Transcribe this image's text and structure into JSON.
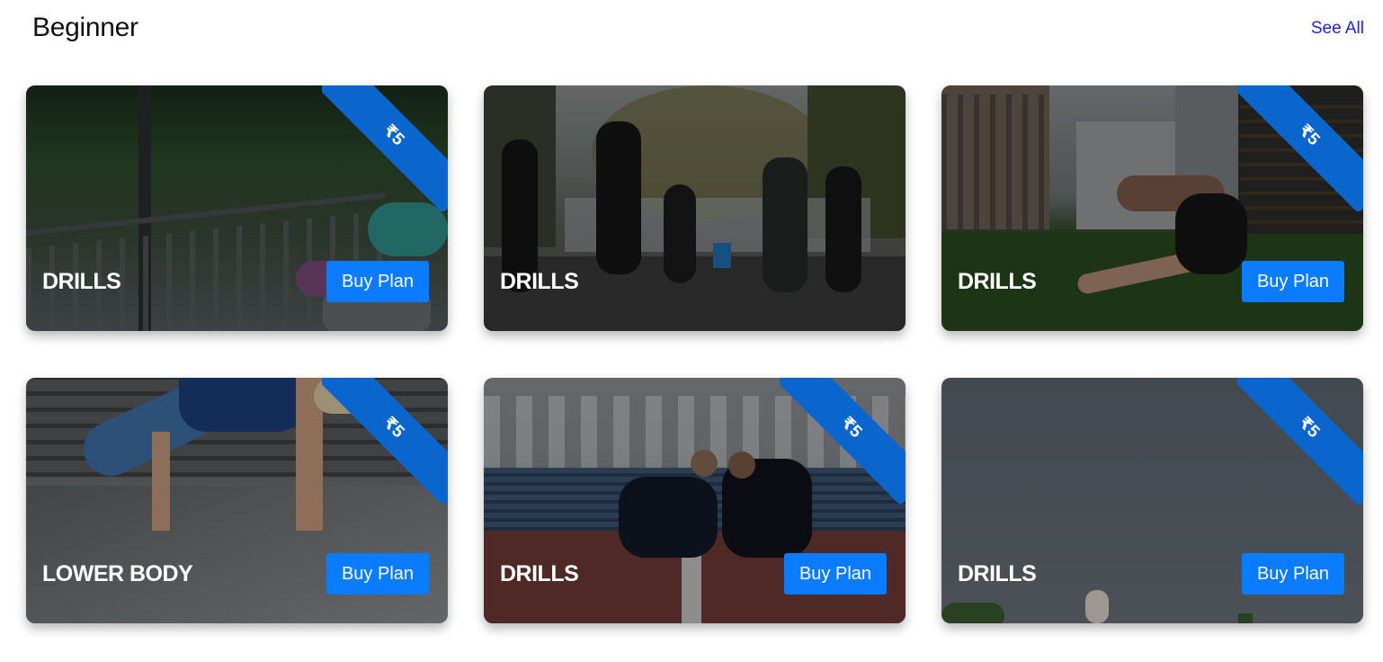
{
  "section": {
    "title": "Beginner",
    "see_all_label": "See All"
  },
  "cards": [
    {
      "title": "DRILLS",
      "button_label": "Buy Plan",
      "price_badge": "₹5",
      "has_badge": true
    },
    {
      "title": "DRILLS",
      "button_label": "Buy Plan",
      "price_badge": "",
      "has_badge": false
    },
    {
      "title": "DRILLS",
      "button_label": "Buy Plan",
      "price_badge": "₹5",
      "has_badge": true
    },
    {
      "title": "LOWER BODY",
      "button_label": "Buy Plan",
      "price_badge": "₹5",
      "has_badge": true
    },
    {
      "title": "DRILLS",
      "button_label": "Buy Plan",
      "price_badge": "₹5",
      "has_badge": true
    },
    {
      "title": "DRILLS",
      "button_label": "Buy Plan",
      "price_badge": "₹5",
      "has_badge": true
    }
  ],
  "colors": {
    "badge": "#0a66cc",
    "button": "#0b7cff",
    "see_all": "#2222cc"
  }
}
